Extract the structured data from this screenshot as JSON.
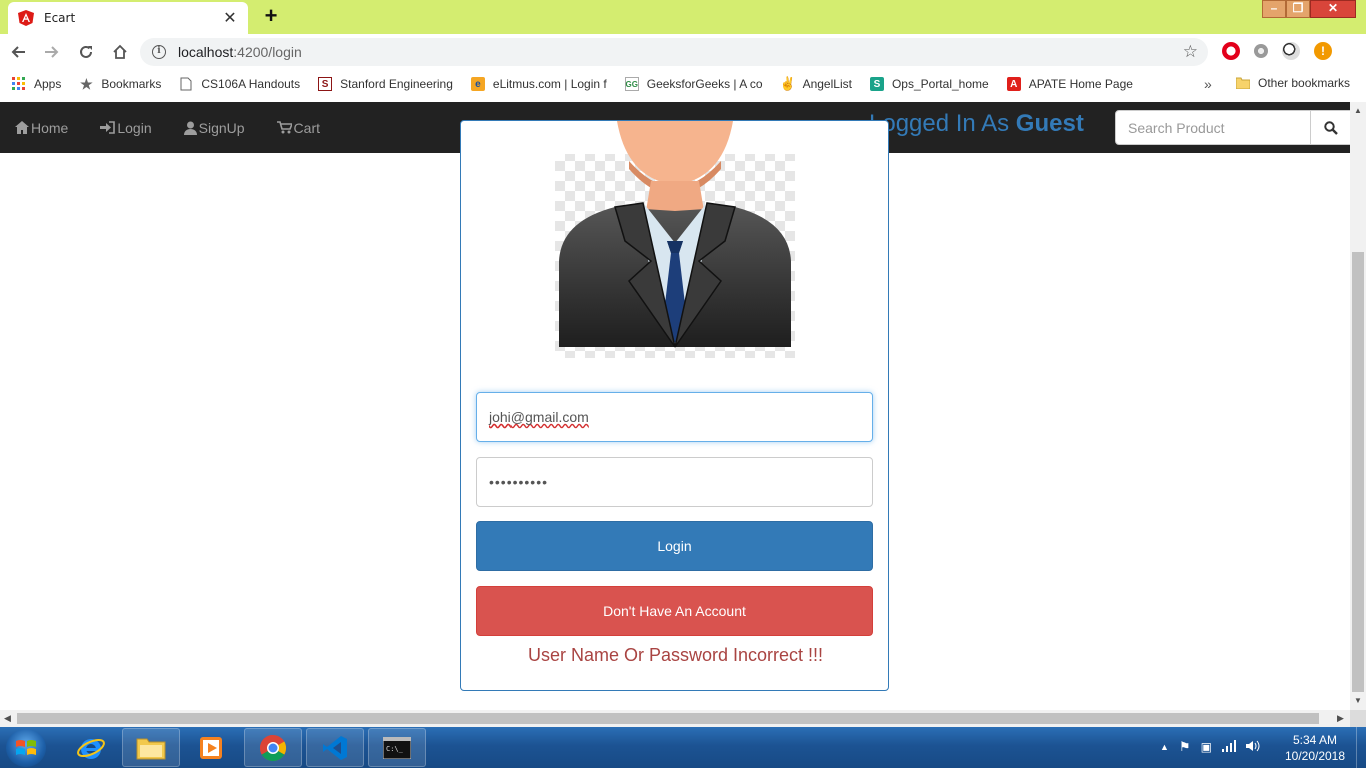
{
  "browser": {
    "tab_title": "Ecart",
    "new_tab": "+",
    "url_host": "localhost",
    "url_path": ":4200/login",
    "bookmarks": [
      {
        "label": "Apps",
        "icon": "apps-grid-icon"
      },
      {
        "label": "Bookmarks",
        "icon": "star-icon"
      },
      {
        "label": "CS106A Handouts",
        "icon": "page-icon"
      },
      {
        "label": "Stanford Engineering",
        "icon": "stanford-icon"
      },
      {
        "label": "eLitmus.com | Login f",
        "icon": "elitmus-icon"
      },
      {
        "label": "GeeksforGeeks | A co",
        "icon": "gfg-icon"
      },
      {
        "label": "AngelList",
        "icon": "angellist-icon"
      },
      {
        "label": "Ops_Portal_home",
        "icon": "ops-portal-icon"
      },
      {
        "label": "APATE Home Page",
        "icon": "apate-icon"
      }
    ],
    "bookmarks_more": "»",
    "other_bookmarks": "Other bookmarks"
  },
  "navbar": {
    "links": [
      {
        "label": "Home",
        "icon": "home-icon"
      },
      {
        "label": "Login",
        "icon": "login-icon"
      },
      {
        "label": "SignUp",
        "icon": "user-icon"
      },
      {
        "label": "Cart",
        "icon": "cart-icon"
      }
    ],
    "logged_prefix": "Logged In As",
    "logged_user": "Guest",
    "search_placeholder": "Search Product"
  },
  "login": {
    "email_value": "johi@gmail.com",
    "password_value": "••••••••••",
    "login_button": "Login",
    "signup_button": "Don't Have An Account",
    "error_message": "User Name Or Password Incorrect !!!"
  },
  "taskbar": {
    "time": "5:34 AM",
    "date": "10/20/2018"
  },
  "colors": {
    "chrome_frame": "#d4ed70",
    "navbar_bg": "#222222",
    "primary": "#337ab7",
    "danger": "#d9534f",
    "error_text": "#a94442"
  }
}
